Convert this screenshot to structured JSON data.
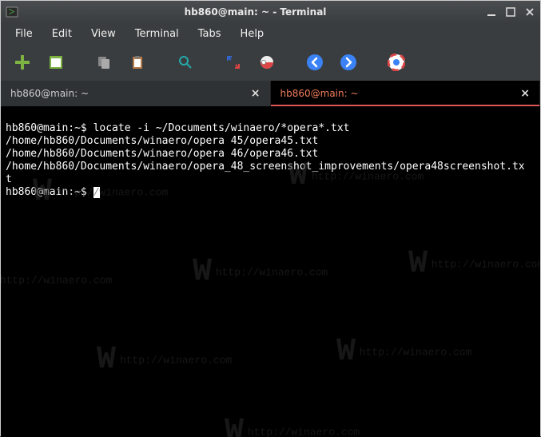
{
  "titlebar": {
    "title": "hb860@main: ~ - Terminal"
  },
  "menu": {
    "file": "File",
    "edit": "Edit",
    "view": "View",
    "terminal": "Terminal",
    "tabs": "Tabs",
    "help": "Help"
  },
  "toolbar_icons": {
    "new_tab": "new-tab-icon",
    "new_window": "new-window-icon",
    "copy": "copy-icon",
    "paste": "paste-icon",
    "search": "search-icon",
    "fullscreen": "fullscreen-icon",
    "preferences": "preferences-icon",
    "go_back": "arrow-left-icon",
    "go_forward": "arrow-right-icon",
    "help": "help-icon"
  },
  "tabs": [
    {
      "label": "hb860@main: ~",
      "active": false
    },
    {
      "label": "hb860@main: ~",
      "active": true
    }
  ],
  "terminal": {
    "prompt": "hb860@main:~$",
    "command": "locate -i ~/Documents/winaero/*opera*.txt",
    "output_lines": [
      "/home/hb860/Documents/winaero/opera 45/opera45.txt",
      "/home/hb860/Documents/winaero/opera 46/opera46.txt",
      "/home/hb860/Documents/winaero/opera_48_screenshot_improvements/opera48screenshot.tx",
      "t"
    ],
    "prompt2": "hb860@main:~$"
  },
  "watermark": {
    "text": "http://winaero.com"
  }
}
